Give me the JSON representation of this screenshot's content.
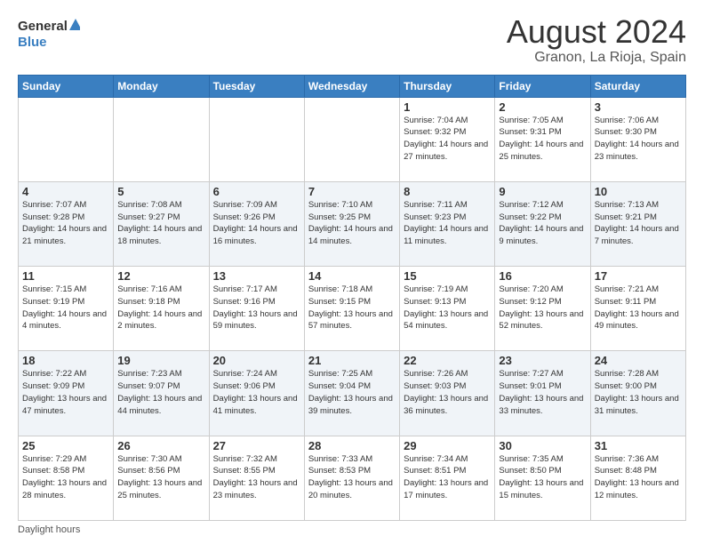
{
  "header": {
    "logo_general": "General",
    "logo_blue": "Blue",
    "title": "August 2024",
    "subtitle": "Granon, La Rioja, Spain"
  },
  "days_of_week": [
    "Sunday",
    "Monday",
    "Tuesday",
    "Wednesday",
    "Thursday",
    "Friday",
    "Saturday"
  ],
  "weeks": [
    [
      {
        "day": "",
        "sunrise": "",
        "sunset": "",
        "daylight": ""
      },
      {
        "day": "",
        "sunrise": "",
        "sunset": "",
        "daylight": ""
      },
      {
        "day": "",
        "sunrise": "",
        "sunset": "",
        "daylight": ""
      },
      {
        "day": "",
        "sunrise": "",
        "sunset": "",
        "daylight": ""
      },
      {
        "day": "1",
        "sunrise": "Sunrise: 7:04 AM",
        "sunset": "Sunset: 9:32 PM",
        "daylight": "Daylight: 14 hours and 27 minutes."
      },
      {
        "day": "2",
        "sunrise": "Sunrise: 7:05 AM",
        "sunset": "Sunset: 9:31 PM",
        "daylight": "Daylight: 14 hours and 25 minutes."
      },
      {
        "day": "3",
        "sunrise": "Sunrise: 7:06 AM",
        "sunset": "Sunset: 9:30 PM",
        "daylight": "Daylight: 14 hours and 23 minutes."
      }
    ],
    [
      {
        "day": "4",
        "sunrise": "Sunrise: 7:07 AM",
        "sunset": "Sunset: 9:28 PM",
        "daylight": "Daylight: 14 hours and 21 minutes."
      },
      {
        "day": "5",
        "sunrise": "Sunrise: 7:08 AM",
        "sunset": "Sunset: 9:27 PM",
        "daylight": "Daylight: 14 hours and 18 minutes."
      },
      {
        "day": "6",
        "sunrise": "Sunrise: 7:09 AM",
        "sunset": "Sunset: 9:26 PM",
        "daylight": "Daylight: 14 hours and 16 minutes."
      },
      {
        "day": "7",
        "sunrise": "Sunrise: 7:10 AM",
        "sunset": "Sunset: 9:25 PM",
        "daylight": "Daylight: 14 hours and 14 minutes."
      },
      {
        "day": "8",
        "sunrise": "Sunrise: 7:11 AM",
        "sunset": "Sunset: 9:23 PM",
        "daylight": "Daylight: 14 hours and 11 minutes."
      },
      {
        "day": "9",
        "sunrise": "Sunrise: 7:12 AM",
        "sunset": "Sunset: 9:22 PM",
        "daylight": "Daylight: 14 hours and 9 minutes."
      },
      {
        "day": "10",
        "sunrise": "Sunrise: 7:13 AM",
        "sunset": "Sunset: 9:21 PM",
        "daylight": "Daylight: 14 hours and 7 minutes."
      }
    ],
    [
      {
        "day": "11",
        "sunrise": "Sunrise: 7:15 AM",
        "sunset": "Sunset: 9:19 PM",
        "daylight": "Daylight: 14 hours and 4 minutes."
      },
      {
        "day": "12",
        "sunrise": "Sunrise: 7:16 AM",
        "sunset": "Sunset: 9:18 PM",
        "daylight": "Daylight: 14 hours and 2 minutes."
      },
      {
        "day": "13",
        "sunrise": "Sunrise: 7:17 AM",
        "sunset": "Sunset: 9:16 PM",
        "daylight": "Daylight: 13 hours and 59 minutes."
      },
      {
        "day": "14",
        "sunrise": "Sunrise: 7:18 AM",
        "sunset": "Sunset: 9:15 PM",
        "daylight": "Daylight: 13 hours and 57 minutes."
      },
      {
        "day": "15",
        "sunrise": "Sunrise: 7:19 AM",
        "sunset": "Sunset: 9:13 PM",
        "daylight": "Daylight: 13 hours and 54 minutes."
      },
      {
        "day": "16",
        "sunrise": "Sunrise: 7:20 AM",
        "sunset": "Sunset: 9:12 PM",
        "daylight": "Daylight: 13 hours and 52 minutes."
      },
      {
        "day": "17",
        "sunrise": "Sunrise: 7:21 AM",
        "sunset": "Sunset: 9:11 PM",
        "daylight": "Daylight: 13 hours and 49 minutes."
      }
    ],
    [
      {
        "day": "18",
        "sunrise": "Sunrise: 7:22 AM",
        "sunset": "Sunset: 9:09 PM",
        "daylight": "Daylight: 13 hours and 47 minutes."
      },
      {
        "day": "19",
        "sunrise": "Sunrise: 7:23 AM",
        "sunset": "Sunset: 9:07 PM",
        "daylight": "Daylight: 13 hours and 44 minutes."
      },
      {
        "day": "20",
        "sunrise": "Sunrise: 7:24 AM",
        "sunset": "Sunset: 9:06 PM",
        "daylight": "Daylight: 13 hours and 41 minutes."
      },
      {
        "day": "21",
        "sunrise": "Sunrise: 7:25 AM",
        "sunset": "Sunset: 9:04 PM",
        "daylight": "Daylight: 13 hours and 39 minutes."
      },
      {
        "day": "22",
        "sunrise": "Sunrise: 7:26 AM",
        "sunset": "Sunset: 9:03 PM",
        "daylight": "Daylight: 13 hours and 36 minutes."
      },
      {
        "day": "23",
        "sunrise": "Sunrise: 7:27 AM",
        "sunset": "Sunset: 9:01 PM",
        "daylight": "Daylight: 13 hours and 33 minutes."
      },
      {
        "day": "24",
        "sunrise": "Sunrise: 7:28 AM",
        "sunset": "Sunset: 9:00 PM",
        "daylight": "Daylight: 13 hours and 31 minutes."
      }
    ],
    [
      {
        "day": "25",
        "sunrise": "Sunrise: 7:29 AM",
        "sunset": "Sunset: 8:58 PM",
        "daylight": "Daylight: 13 hours and 28 minutes."
      },
      {
        "day": "26",
        "sunrise": "Sunrise: 7:30 AM",
        "sunset": "Sunset: 8:56 PM",
        "daylight": "Daylight: 13 hours and 25 minutes."
      },
      {
        "day": "27",
        "sunrise": "Sunrise: 7:32 AM",
        "sunset": "Sunset: 8:55 PM",
        "daylight": "Daylight: 13 hours and 23 minutes."
      },
      {
        "day": "28",
        "sunrise": "Sunrise: 7:33 AM",
        "sunset": "Sunset: 8:53 PM",
        "daylight": "Daylight: 13 hours and 20 minutes."
      },
      {
        "day": "29",
        "sunrise": "Sunrise: 7:34 AM",
        "sunset": "Sunset: 8:51 PM",
        "daylight": "Daylight: 13 hours and 17 minutes."
      },
      {
        "day": "30",
        "sunrise": "Sunrise: 7:35 AM",
        "sunset": "Sunset: 8:50 PM",
        "daylight": "Daylight: 13 hours and 15 minutes."
      },
      {
        "day": "31",
        "sunrise": "Sunrise: 7:36 AM",
        "sunset": "Sunset: 8:48 PM",
        "daylight": "Daylight: 13 hours and 12 minutes."
      }
    ]
  ],
  "footer": {
    "note": "Daylight hours"
  }
}
